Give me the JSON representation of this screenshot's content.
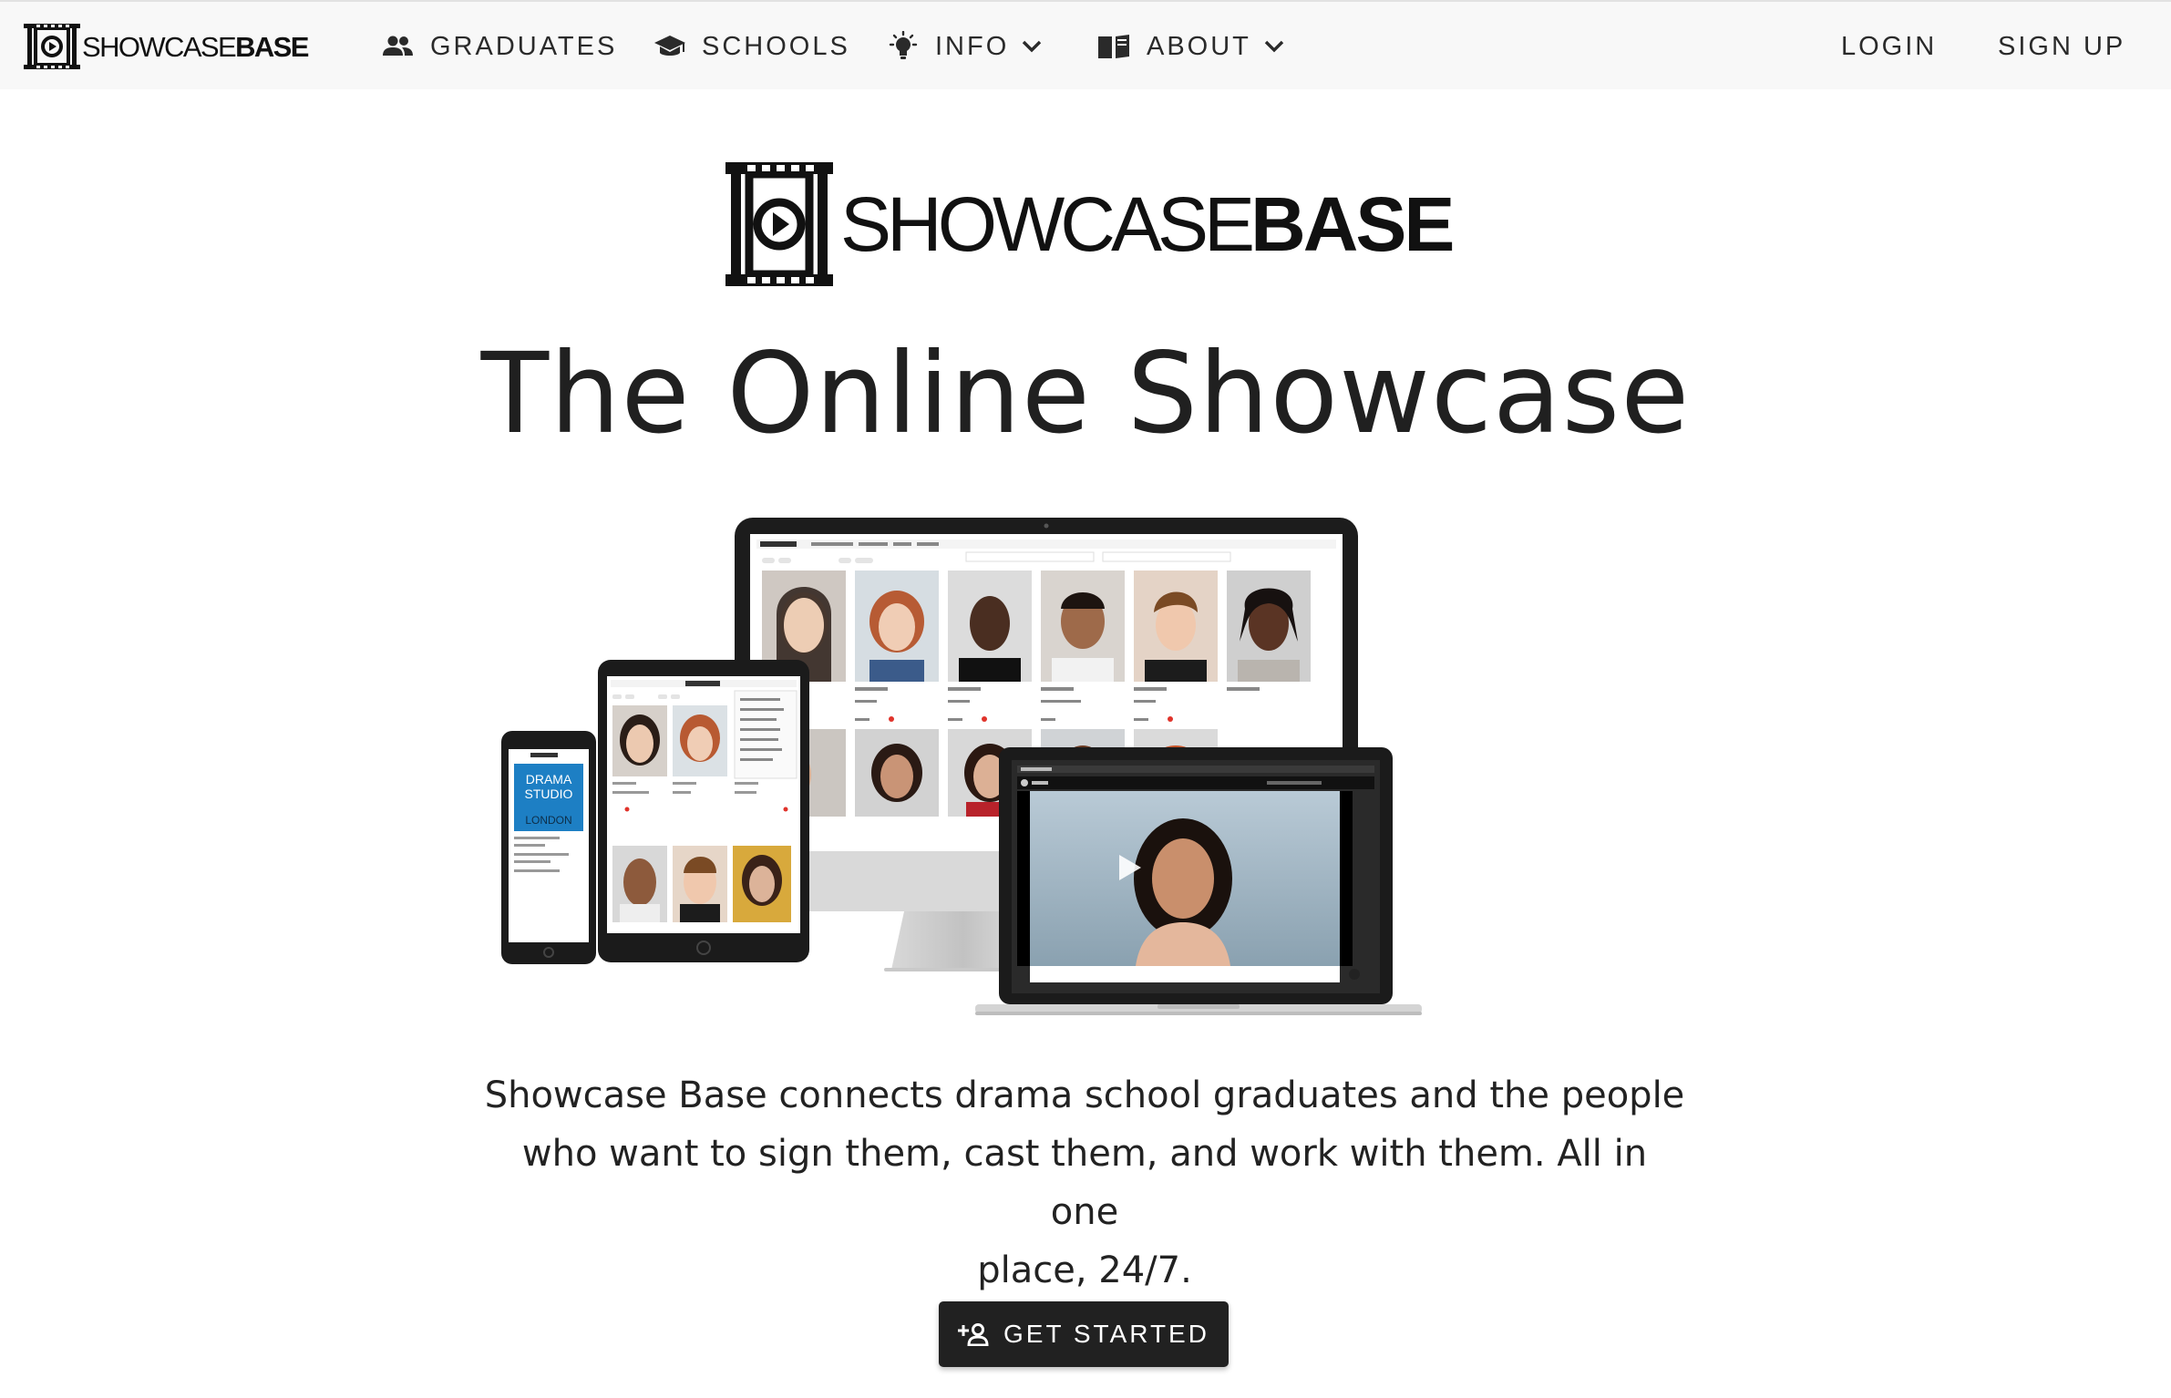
{
  "brand": {
    "name_light": "SHOWCASE",
    "name_bold": "BASE"
  },
  "nav": {
    "graduates": "GRADUATES",
    "schools": "SCHOOLS",
    "info": "INFO",
    "about": "ABOUT",
    "login": "LOGIN",
    "signup": "SIGN UP"
  },
  "hero": {
    "headline": "The Online Showcase",
    "tagline_line1": "Showcase Base connects drama school graduates and the people",
    "tagline_line2": "who want to sign them, cast them, and work with them. All in one",
    "tagline_line3": "place, 24/7.",
    "cta_label": "GET STARTED",
    "illustration_text": {
      "studio_line1": "DRAMA",
      "studio_line2": "STUDIO",
      "studio_line3": "LONDON"
    }
  },
  "colors": {
    "navbar_bg": "#f8f8f8",
    "text": "#222222",
    "cta_bg": "#212121",
    "cta_text": "#ffffff",
    "studio_blue": "#1d7fc4"
  },
  "icons": [
    "film-logo-icon",
    "people-icon",
    "graduation-cap-icon",
    "lightbulb-icon",
    "book-icon",
    "chevron-down-icon",
    "add-person-icon",
    "play-icon"
  ]
}
